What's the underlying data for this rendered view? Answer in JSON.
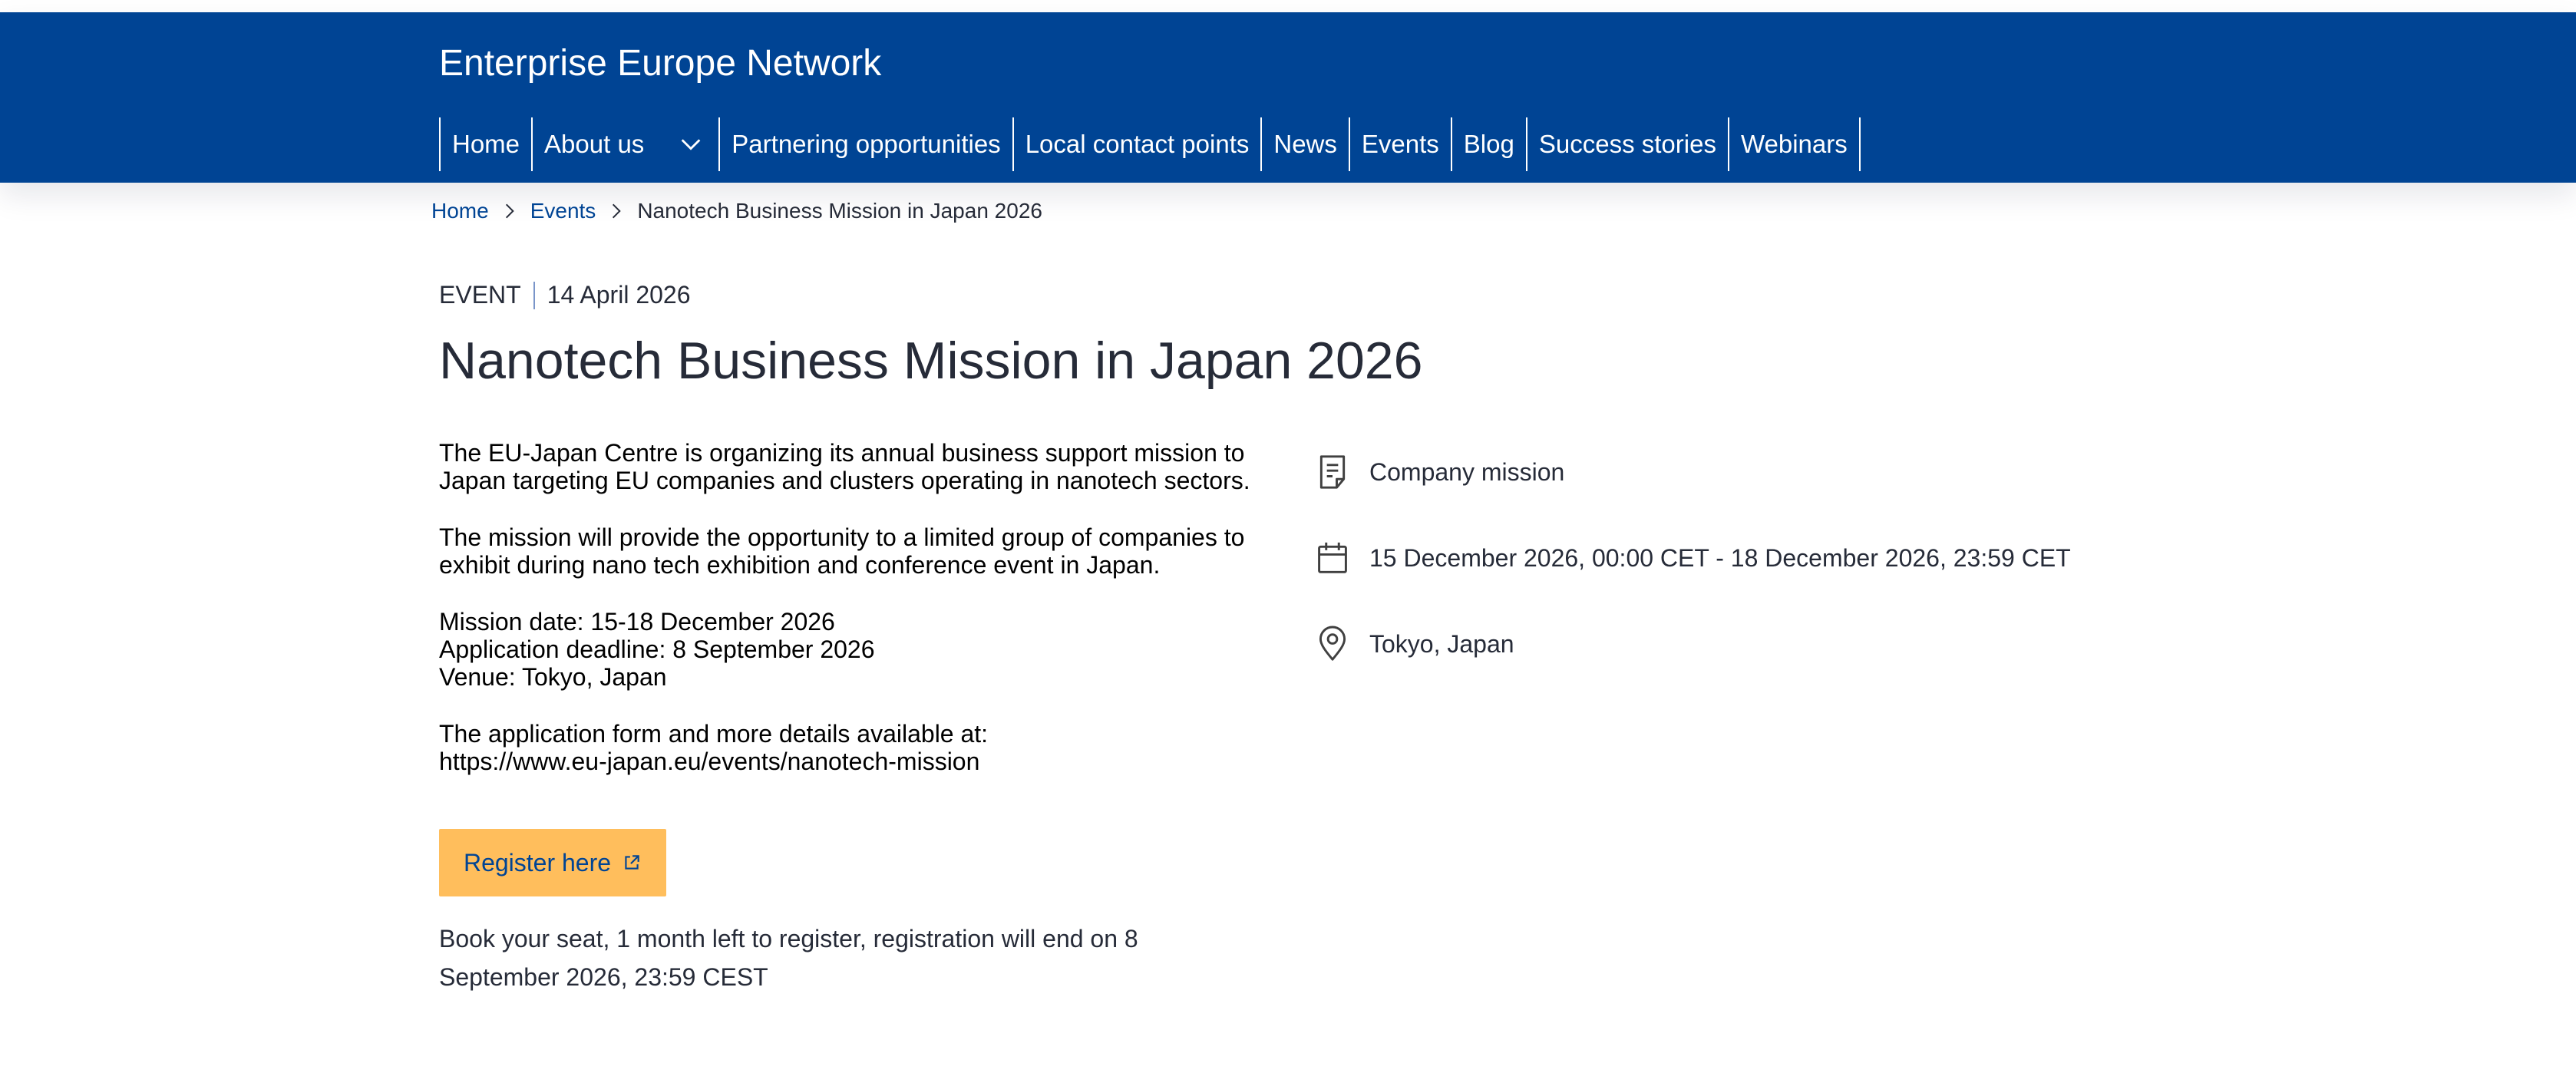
{
  "header": {
    "site_name": "Enterprise Europe Network",
    "background_color": "#004494",
    "nav": [
      {
        "label": "Home"
      },
      {
        "label": "About us",
        "has_dropdown": true
      },
      {
        "label": "Partnering opportunities"
      },
      {
        "label": "Local contact points"
      },
      {
        "label": "News"
      },
      {
        "label": "Events"
      },
      {
        "label": "Blog"
      },
      {
        "label": "Success stories"
      },
      {
        "label": "Webinars"
      }
    ]
  },
  "breadcrumb": {
    "items": [
      "Home",
      "Events"
    ],
    "current": "Nanotech Business Mission in Japan 2026"
  },
  "event": {
    "type": "EVENT",
    "date": "14 April 2026",
    "title": "Nanotech Business Mission in Japan 2026",
    "description": {
      "p1": "The EU-Japan Centre is organizing its annual business support mission to Japan targeting EU companies and clusters operating in nanotech sectors.",
      "p2": "The mission will provide the opportunity to a limited group of companies to exhibit during nano tech exhibition and conference event in Japan.",
      "mission_date": "Mission date: 15-18 December 2026",
      "application_deadline": "Application deadline: 8 September 2026",
      "venue": "Venue: Tokyo, Japan",
      "details_intro": "The application form and more details available at:",
      "details_url": "https://www.eu-japan.eu/events/nanotech-mission"
    },
    "register_label": "Register here",
    "register_color": "#ffbe5c",
    "register_note": "Book your seat, 1 month left to register, registration will end on 8 September 2026, 23:59 CEST"
  },
  "info": {
    "category": {
      "icon": "document-icon",
      "text": "Company mission"
    },
    "datetime": {
      "icon": "calendar-icon",
      "text": "15 December 2026, 00:00 CET - 18 December 2026, 23:59 CET"
    },
    "location": {
      "icon": "location-pin-icon",
      "text": "Tokyo, Japan"
    }
  }
}
